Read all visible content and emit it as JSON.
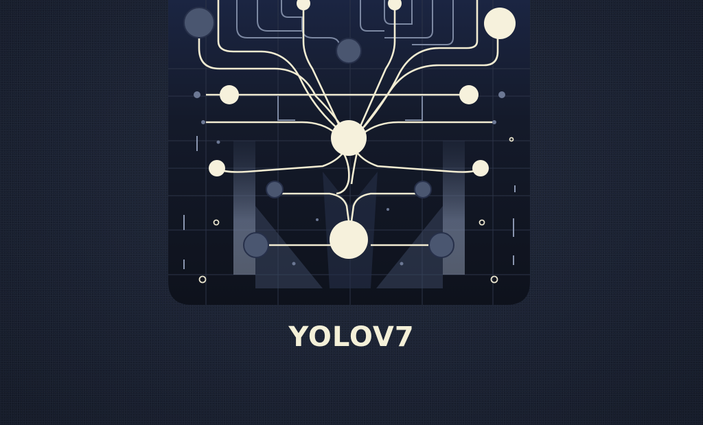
{
  "logo": {
    "wordmark": "YOLOV7",
    "icon": "neural-network-tree-icon"
  },
  "colors": {
    "background": "#1b2233",
    "panel": "#10141f",
    "node_light": "#f6f1dc",
    "node_dark": "#4a5670",
    "line": "#f2ecd2",
    "line_dim": "#7a86a0"
  }
}
